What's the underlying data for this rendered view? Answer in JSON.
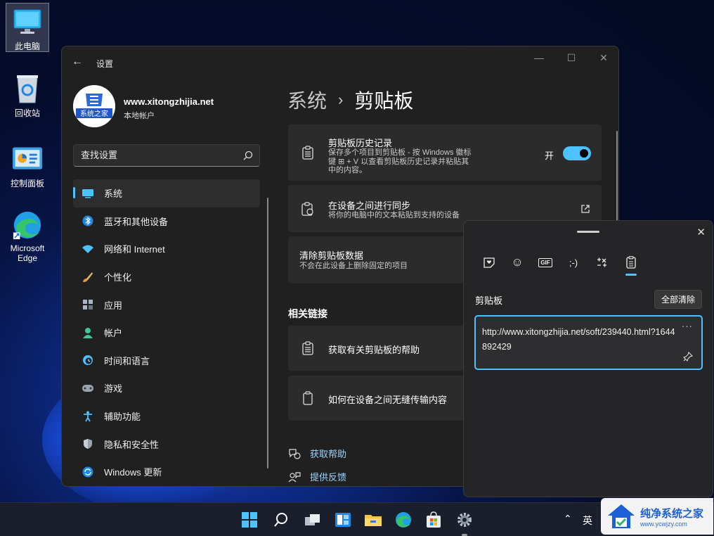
{
  "desktop": {
    "icons": [
      {
        "label": "此电脑",
        "icon": "monitor-icon"
      },
      {
        "label": "回收站",
        "icon": "recycle-bin-icon"
      },
      {
        "label": "控制面板",
        "icon": "control-panel-icon"
      },
      {
        "label": "Microsoft Edge",
        "icon": "edge-icon"
      }
    ]
  },
  "window": {
    "title": "设置",
    "back": "←",
    "min": "—",
    "max": "☐",
    "close": "✕"
  },
  "profile": {
    "name": "www.xitongzhijia.net",
    "type": "本地帐户",
    "logo_text": "系统之家"
  },
  "search": {
    "placeholder": "查找设置"
  },
  "nav": {
    "items": [
      {
        "label": "系统",
        "icon": "system-icon",
        "active": true
      },
      {
        "label": "蓝牙和其他设备",
        "icon": "bluetooth-icon"
      },
      {
        "label": "网络和 Internet",
        "icon": "wifi-icon"
      },
      {
        "label": "个性化",
        "icon": "brush-icon"
      },
      {
        "label": "应用",
        "icon": "apps-icon"
      },
      {
        "label": "帐户",
        "icon": "account-icon"
      },
      {
        "label": "时间和语言",
        "icon": "time-language-icon"
      },
      {
        "label": "游戏",
        "icon": "gamepad-icon"
      },
      {
        "label": "辅助功能",
        "icon": "accessibility-icon"
      },
      {
        "label": "隐私和安全性",
        "icon": "shield-icon"
      },
      {
        "label": "Windows 更新",
        "icon": "update-icon"
      }
    ]
  },
  "page": {
    "crumb": "系统",
    "separator": "›",
    "title": "剪贴板",
    "history": {
      "title": "剪贴板历史记录",
      "desc": "保存多个项目到剪贴板 - 按 Windows 徽标键 ⊞ + V 以查看剪贴板历史记录并粘贴其中的内容。",
      "toggle_label": "开",
      "toggle_on": true
    },
    "sync": {
      "title": "在设备之间进行同步",
      "desc": "将你的电脑中的文本粘贴到支持的设备"
    },
    "clear": {
      "title": "清除剪贴板数据",
      "desc": "不会在此设备上删除固定的项目"
    },
    "related_title": "相关链接",
    "related": [
      {
        "label": "获取有关剪贴板的帮助",
        "icon": "clipboard-icon"
      },
      {
        "label": "如何在设备之间无缝传输内容",
        "icon": "phone-icon"
      }
    ],
    "help_links": [
      {
        "label": "获取帮助",
        "icon": "help-icon"
      },
      {
        "label": "提供反馈",
        "icon": "feedback-icon"
      }
    ]
  },
  "clipboard_panel": {
    "close": "✕",
    "tabs": [
      {
        "label": "",
        "icon": "sticker-icon"
      },
      {
        "label": "☺",
        "icon": "emoji-icon"
      },
      {
        "label": "GIF",
        "icon": "gif-icon"
      },
      {
        "label": ";-)",
        "icon": "kaomoji-icon"
      },
      {
        "label": "",
        "icon": "symbols-icon"
      },
      {
        "label": "",
        "icon": "clipboard-history-icon",
        "active": true
      }
    ],
    "heading": "剪贴板",
    "clear_all": "全部清除",
    "items": [
      {
        "text": "http://www.xitongzhijia.net/soft/239440.html?1644892429",
        "more": "···"
      }
    ]
  },
  "taskbar": {
    "icons": [
      "start-icon",
      "search-icon",
      "task-view-icon",
      "widgets-icon",
      "file-explorer-icon",
      "edge-icon",
      "store-icon",
      "settings-icon"
    ],
    "tray_chevron": "⌃",
    "language": "英"
  },
  "watermark": {
    "text": "纯净系统之家",
    "url": "www.ycwjzy.com"
  },
  "colors": {
    "accent": "#4cc2ff",
    "window_bg": "#202020",
    "card_bg": "#2b2b2b"
  }
}
